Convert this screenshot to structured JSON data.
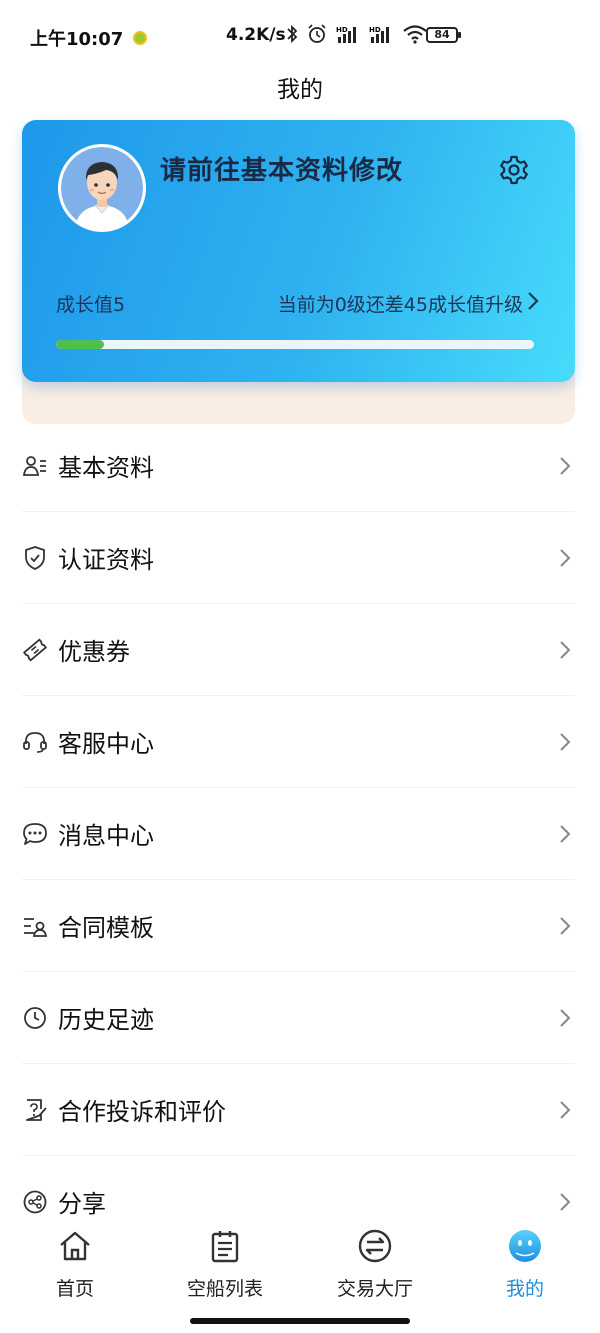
{
  "status_bar": {
    "time": "上午10:07",
    "net_speed": "4.2K/s",
    "battery": "84"
  },
  "page_title": "我的",
  "profile": {
    "name": "请前往基本资料修改",
    "growth_label": "成长值5",
    "level_message": "当前为0级还差45成长值升级",
    "progress_fraction": 0.1,
    "gradient_start": "#1e98ea",
    "gradient_end": "#47dcfb",
    "progress_color": "#4fc04e"
  },
  "menu": [
    {
      "label": "基本资料",
      "icon": "profile-list-icon"
    },
    {
      "label": "认证资料",
      "icon": "shield-check-icon"
    },
    {
      "label": "优惠券",
      "icon": "coupon-icon"
    },
    {
      "label": "客服中心",
      "icon": "headset-icon"
    },
    {
      "label": "消息中心",
      "icon": "chat-bubble-icon"
    },
    {
      "label": "合同模板",
      "icon": "contract-icon"
    },
    {
      "label": "历史足迹",
      "icon": "clock-icon"
    },
    {
      "label": "合作投诉和评价",
      "icon": "complaint-icon"
    },
    {
      "label": "分享",
      "icon": "share-icon"
    }
  ],
  "tabs": [
    {
      "label": "首页",
      "icon": "home-icon"
    },
    {
      "label": "空船列表",
      "icon": "clipboard-list-icon"
    },
    {
      "label": "交易大厅",
      "icon": "exchange-icon"
    },
    {
      "label": "我的",
      "icon": "smiley-face-icon",
      "active": true
    }
  ],
  "accent_color": "#1e8fe0"
}
